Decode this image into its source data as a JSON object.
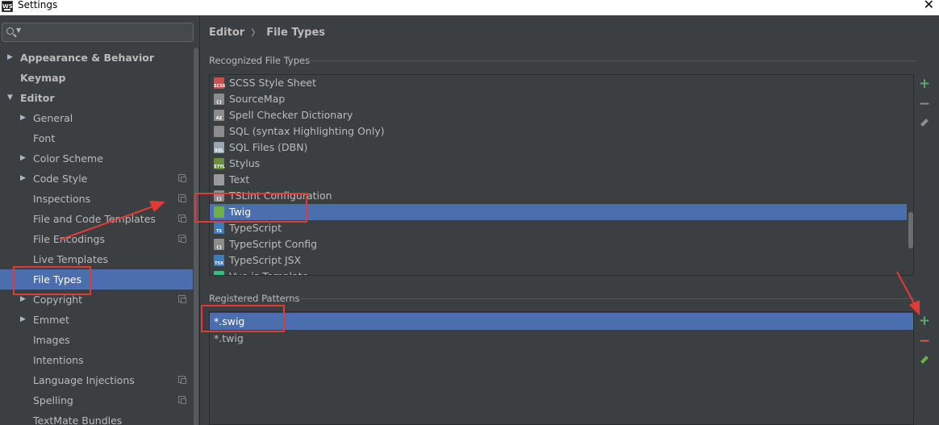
{
  "window": {
    "title": "Settings",
    "app_icon_text": "WS"
  },
  "search": {
    "placeholder": ""
  },
  "tree": [
    {
      "label": "Appearance & Behavior",
      "level": 0,
      "arrow": "▶",
      "bold": true,
      "proj": false,
      "selected": false
    },
    {
      "label": "Keymap",
      "level": 0,
      "arrow": "",
      "bold": true,
      "proj": false,
      "selected": false
    },
    {
      "label": "Editor",
      "level": 0,
      "arrow": "▼",
      "bold": true,
      "proj": false,
      "selected": false
    },
    {
      "label": "General",
      "level": 1,
      "arrow": "▶",
      "bold": false,
      "proj": false,
      "selected": false
    },
    {
      "label": "Font",
      "level": 1,
      "arrow": "",
      "bold": false,
      "proj": false,
      "selected": false
    },
    {
      "label": "Color Scheme",
      "level": 1,
      "arrow": "▶",
      "bold": false,
      "proj": false,
      "selected": false
    },
    {
      "label": "Code Style",
      "level": 1,
      "arrow": "▶",
      "bold": false,
      "proj": true,
      "selected": false
    },
    {
      "label": "Inspections",
      "level": 1,
      "arrow": "",
      "bold": false,
      "proj": true,
      "selected": false
    },
    {
      "label": "File and Code Templates",
      "level": 1,
      "arrow": "",
      "bold": false,
      "proj": true,
      "selected": false
    },
    {
      "label": "File Encodings",
      "level": 1,
      "arrow": "",
      "bold": false,
      "proj": true,
      "selected": false
    },
    {
      "label": "Live Templates",
      "level": 1,
      "arrow": "",
      "bold": false,
      "proj": false,
      "selected": false
    },
    {
      "label": "File Types",
      "level": 1,
      "arrow": "",
      "bold": false,
      "proj": false,
      "selected": true
    },
    {
      "label": "Copyright",
      "level": 1,
      "arrow": "▶",
      "bold": false,
      "proj": true,
      "selected": false
    },
    {
      "label": "Emmet",
      "level": 1,
      "arrow": "▶",
      "bold": false,
      "proj": false,
      "selected": false
    },
    {
      "label": "Images",
      "level": 1,
      "arrow": "",
      "bold": false,
      "proj": false,
      "selected": false
    },
    {
      "label": "Intentions",
      "level": 1,
      "arrow": "",
      "bold": false,
      "proj": false,
      "selected": false
    },
    {
      "label": "Language Injections",
      "level": 1,
      "arrow": "",
      "bold": false,
      "proj": true,
      "selected": false
    },
    {
      "label": "Spelling",
      "level": 1,
      "arrow": "",
      "bold": false,
      "proj": true,
      "selected": false
    },
    {
      "label": "TextMate Bundles",
      "level": 1,
      "arrow": "",
      "bold": false,
      "proj": false,
      "selected": false
    }
  ],
  "breadcrumb": {
    "parent": "Editor",
    "separator": "〉",
    "current": "File Types"
  },
  "recognized": {
    "title": "Recognized File Types",
    "items": [
      {
        "label": "SCSS Style Sheet",
        "icon": "scss-icon",
        "color": "#c94f4f",
        "tag": "SCSS",
        "selected": false
      },
      {
        "label": "SourceMap",
        "icon": "sourcemap-icon",
        "color": "#8c8c8c",
        "tag": "{}",
        "selected": false
      },
      {
        "label": "Spell Checker Dictionary",
        "icon": "dictionary-icon",
        "color": "#8c8c8c",
        "tag": "AZ",
        "selected": false
      },
      {
        "label": "SQL (syntax Highlighting Only)",
        "icon": "sql-icon",
        "color": "#8c8c8c",
        "tag": "",
        "selected": false
      },
      {
        "label": "SQL Files (DBN)",
        "icon": "sql-dbn-icon",
        "color": "#9aa6b4",
        "tag": "SQL",
        "selected": false
      },
      {
        "label": "Stylus",
        "icon": "stylus-icon",
        "color": "#6a8f3c",
        "tag": "STYL",
        "selected": false
      },
      {
        "label": "Text",
        "icon": "text-file-icon",
        "color": "#9a9a9a",
        "tag": "",
        "selected": false
      },
      {
        "label": "TSLint Configuration",
        "icon": "tslint-icon",
        "color": "#8c8c8c",
        "tag": "{}",
        "selected": false
      },
      {
        "label": "Twig",
        "icon": "twig-icon",
        "color": "#6fae49",
        "tag": "",
        "selected": true
      },
      {
        "label": "TypeScript",
        "icon": "typescript-icon",
        "color": "#3f7bb5",
        "tag": "TS",
        "selected": false
      },
      {
        "label": "TypeScript Config",
        "icon": "tsconfig-icon",
        "color": "#8c8c8c",
        "tag": "{}",
        "selected": false
      },
      {
        "label": "TypeScript JSX",
        "icon": "tsx-icon",
        "color": "#3f7bb5",
        "tag": "TSX",
        "selected": false
      },
      {
        "label": "Vue.js Template",
        "icon": "vue-icon",
        "color": "#41b883",
        "tag": "",
        "selected": false
      }
    ]
  },
  "patterns": {
    "title": "Registered Patterns",
    "items": [
      {
        "label": "*.swig",
        "selected": true
      },
      {
        "label": "*.twig",
        "selected": false
      }
    ]
  },
  "buttons": {
    "add": "+",
    "remove": "−"
  },
  "colors": {
    "background": "#3c3f41",
    "selection": "#4b6eaf",
    "add": "#59a869",
    "remove": "#d95b4d",
    "annotation": "#e53935"
  }
}
